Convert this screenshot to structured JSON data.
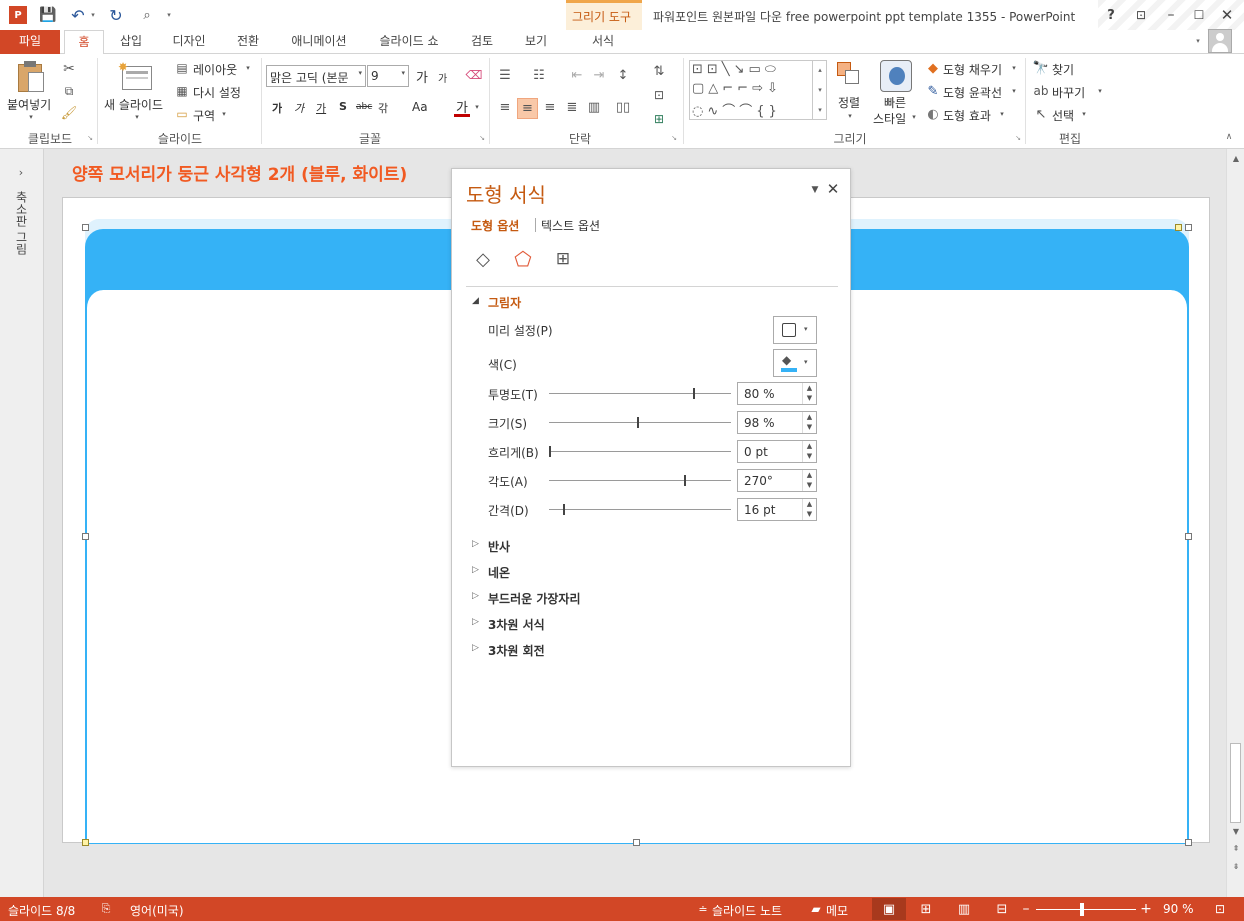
{
  "window": {
    "title": "파워포인트 원본파일 다운 free powerpoint ppt template 1355 - PowerPoint",
    "contextual_group": "그리기 도구",
    "help": "?"
  },
  "tabs": {
    "file": "파일",
    "home": "홈",
    "insert": "삽입",
    "design": "디자인",
    "transitions": "전환",
    "animations": "애니메이션",
    "slideshow": "슬라이드 쇼",
    "review": "검토",
    "view": "보기",
    "format": "서식"
  },
  "ribbon": {
    "clipboard": {
      "paste": "붙여넣기",
      "label": "클립보드"
    },
    "slides": {
      "new_slide": "새 슬라이드",
      "layout": "레이아웃",
      "reset": "다시 설정",
      "section": "구역",
      "label": "슬라이드"
    },
    "font": {
      "name": "맑은 고딕 (본문",
      "size": "9",
      "label": "글꼴",
      "grow": "가",
      "shrink": "가",
      "bold": "가",
      "italic": "가",
      "underline": "가",
      "shadow": "S",
      "strike": "abc",
      "spacing": "갂",
      "case": "Aa",
      "color": "가"
    },
    "paragraph": {
      "label": "단락"
    },
    "drawing": {
      "arrange": "정렬",
      "quick_styles": "빠른",
      "quick_styles2": "스타일",
      "fill": "도형 채우기",
      "outline": "도형 윤곽선",
      "effects": "도형 효과",
      "label": "그리기"
    },
    "editing": {
      "find": "찾기",
      "replace": "바꾸기",
      "select": "선택",
      "label": "편집"
    }
  },
  "left_pane": {
    "label": "축소판 그림"
  },
  "slide": {
    "title": "양쪽 모서리가 둥근 사각형 2개 (블루, 화이트)",
    "blue": "#35b2f6",
    "title_color": "#f15a22"
  },
  "format_panel": {
    "title": "도형 서식",
    "tab_shape": "도형 옵션",
    "tab_text": "텍스트 옵션",
    "section_shadow": "그림자",
    "preset": "미리 설정(P)",
    "color": "색(C)",
    "transparency": {
      "label": "투명도(T)",
      "value": "80 %",
      "level": 0.8
    },
    "size": {
      "label": "크기(S)",
      "value": "98 %",
      "level": 0.49
    },
    "blur": {
      "label": "흐리게(B)",
      "value": "0 pt",
      "level": 0
    },
    "angle": {
      "label": "각도(A)",
      "value": "270°",
      "level": 0.75
    },
    "distance": {
      "label": "간격(D)",
      "value": "16 pt",
      "level": 0.08
    },
    "sections": [
      "반사",
      "네온",
      "부드러운 가장자리",
      "3차원 서식",
      "3차원 회전"
    ]
  },
  "status": {
    "slide_count": "슬라이드 8/8",
    "language": "영어(미국)",
    "notes": "슬라이드 노트",
    "comments": "메모",
    "zoom": "90 %"
  },
  "colors": {
    "accent": "#d24726",
    "orange_text": "#c55a11"
  }
}
